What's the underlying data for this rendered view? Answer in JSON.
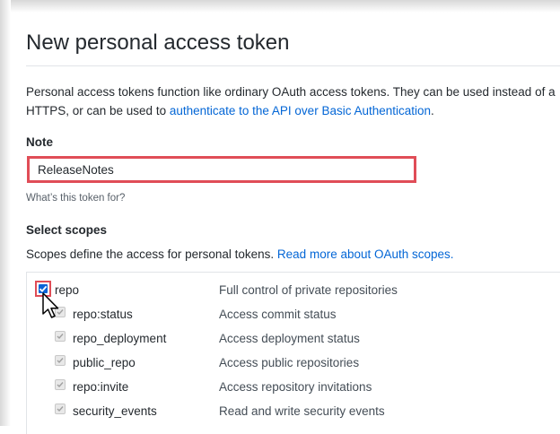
{
  "header": {
    "title": "New personal access token"
  },
  "intro": {
    "text_before": "Personal access tokens function like ordinary OAuth access tokens. They can be used instead of a",
    "text_line2_before": "HTTPS, or can be used to ",
    "link": "authenticate to the API over Basic Authentication",
    "text_after": "."
  },
  "note": {
    "label": "Note",
    "value": "ReleaseNotes",
    "hint": "What’s this token for?"
  },
  "scopes": {
    "label": "Select scopes",
    "desc_before": "Scopes define the access for personal tokens. ",
    "desc_link": "Read more about OAuth scopes.",
    "items": [
      {
        "name": "repo",
        "description": "Full control of private repositories",
        "checked": true
      },
      {
        "name": "repo:status",
        "description": "Access commit status",
        "checked": true
      },
      {
        "name": "repo_deployment",
        "description": "Access deployment status",
        "checked": true
      },
      {
        "name": "public_repo",
        "description": "Access public repositories",
        "checked": true
      },
      {
        "name": "repo:invite",
        "description": "Access repository invitations",
        "checked": true
      },
      {
        "name": "security_events",
        "description": "Read and write security events",
        "checked": true
      }
    ]
  },
  "colors": {
    "link": "#0366d6",
    "highlight": "#e04d57",
    "checkbox": "#0a63d6"
  }
}
